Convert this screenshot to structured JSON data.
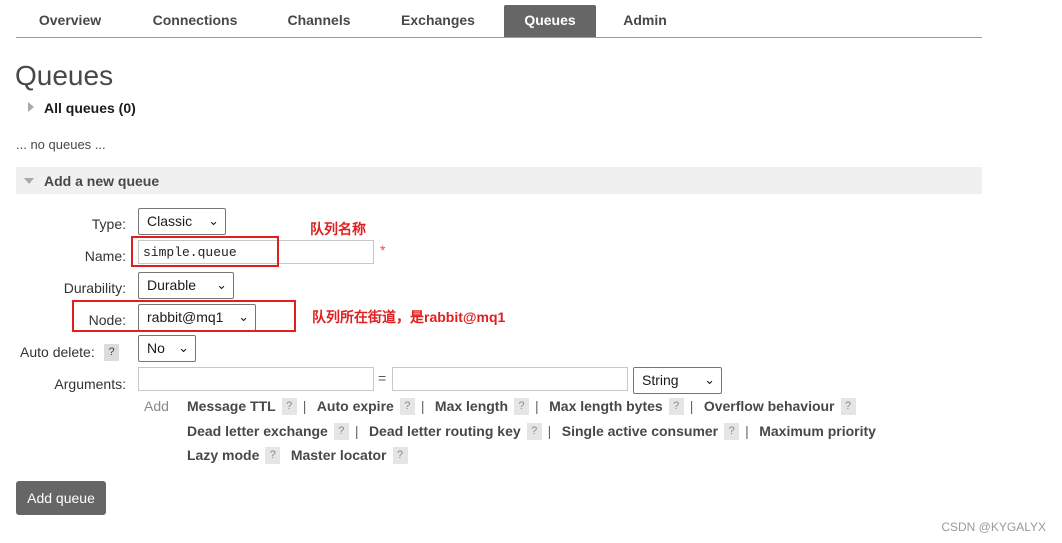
{
  "nav": {
    "tabs": [
      {
        "label": "Overview"
      },
      {
        "label": "Connections"
      },
      {
        "label": "Channels"
      },
      {
        "label": "Exchanges"
      },
      {
        "label": "Queues"
      },
      {
        "label": "Admin"
      }
    ],
    "active_tab": "Queues"
  },
  "page_title": "Queues",
  "all_queues": {
    "label": "All queues (0)"
  },
  "no_queues_text": "... no queues ...",
  "add_section": {
    "label": "Add a new queue"
  },
  "form": {
    "type": {
      "label": "Type:",
      "value": "Classic"
    },
    "name": {
      "label": "Name:",
      "value": "simple.queue",
      "required_marker": "*"
    },
    "durability": {
      "label": "Durability:",
      "value": "Durable"
    },
    "node": {
      "label": "Node:",
      "value": "rabbit@mq1"
    },
    "auto_delete": {
      "label": "Auto delete:",
      "help": "?",
      "value": "No"
    },
    "arguments": {
      "label": "Arguments:",
      "equals": "=",
      "type_value": "String"
    }
  },
  "add_label": "Add",
  "arg_shortcuts": {
    "line1": [
      "Message TTL",
      "Auto expire",
      "Max length",
      "Max length bytes",
      "Overflow behaviour"
    ],
    "line2": [
      "Dead letter exchange",
      "Dead letter routing key",
      "Single active consumer",
      "Maximum priority"
    ],
    "line3": [
      "Lazy mode",
      "Master locator"
    ],
    "help": "?",
    "separator": "|"
  },
  "submit_button": "Add queue",
  "annotations": {
    "name_note": "队列名称",
    "node_note": "队列所在街道，是rabbit@mq1"
  },
  "watermark": "CSDN @KYGALYX",
  "colors": {
    "accent": "#666666",
    "annotation": "#e02020"
  }
}
